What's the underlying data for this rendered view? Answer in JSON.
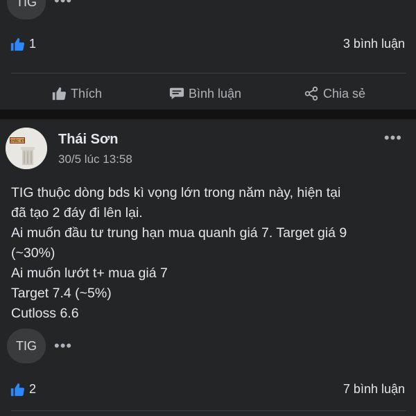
{
  "prev_post": {
    "tag": "TIG",
    "like_count": "1",
    "comment_count": "3 bình luận",
    "actions": {
      "like": "Thích",
      "comment": "Bình luận",
      "share": "Chia sẻ"
    }
  },
  "post": {
    "author": "Thái Sơn",
    "timestamp": "30/5 lúc 13:58",
    "avatar_text": "KHẮC KỲ",
    "lines": [
      "TIG thuộc dòng bds kì vọng lớn trong năm này, hiện tại",
      "đã tạo 2 đáy đi lên lại.",
      "Ai muốn đầu tư trung hạn mua quanh giá 7. Target giá 9",
      "(~30%)",
      "Ai muốn lướt t+ mua giá 7",
      "Target 7.4 (~5%)",
      "Cutloss 6.6"
    ],
    "tag": "TIG",
    "like_count": "2",
    "comment_count": "7 bình luận"
  },
  "colors": {
    "background": "#1b1b1b",
    "card": "#242526",
    "like_blue": "#2d88ff",
    "text": "#e4e6eb",
    "muted": "#b0b3b8"
  }
}
